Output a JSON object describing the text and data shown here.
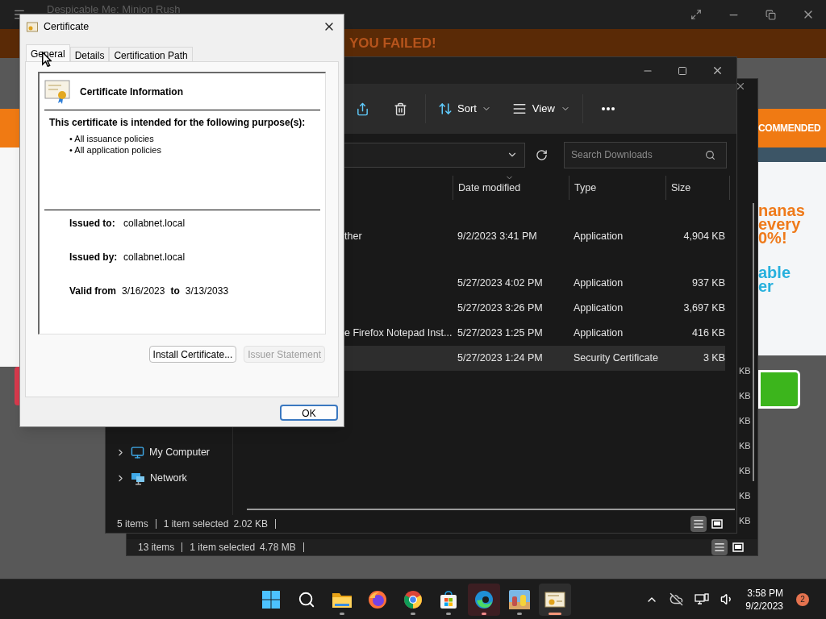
{
  "game": {
    "title": "Despicable Me: Minion Rush",
    "banner": "YOU FAILED!",
    "ribbon": "COMMENDED",
    "promo_orange": [
      "nanas",
      "every",
      "0%!"
    ],
    "promo_blue": [
      "able",
      "er"
    ]
  },
  "back_explorer": {
    "size_fragments": [
      "KB",
      "KB",
      "KB",
      "KB",
      "KB",
      "KB",
      "KB"
    ],
    "status": {
      "count": "13 items",
      "selection": "1 item selected",
      "size": "4.78 MB"
    },
    "view_modes": [
      {
        "kind": "details",
        "selected": true
      },
      {
        "kind": "tiles",
        "selected": false
      }
    ]
  },
  "explorer": {
    "toolbar": [
      {
        "kind": "share"
      },
      {
        "kind": "delete"
      },
      {
        "kind": "sort",
        "label": "Sort"
      },
      {
        "kind": "view",
        "label": "View"
      },
      {
        "kind": "more"
      }
    ],
    "search": {
      "placeholder": "Search Downloads"
    },
    "columns": [
      "Date modified",
      "Type",
      "Size"
    ],
    "groups": [
      {
        "rows": [
          {
            "name": "ther",
            "date": "9/2/2023 3:41 PM",
            "type": "Application",
            "size": "4,904 KB",
            "selected": false
          }
        ]
      },
      {
        "rows": [
          {
            "date": "5/27/2023 4:02 PM",
            "type": "Application",
            "size": "937 KB",
            "selected": false
          },
          {
            "date": "5/27/2023 3:26 PM",
            "type": "Application",
            "size": "3,697 KB",
            "selected": false
          },
          {
            "name": "e Firefox Notepad Inst...",
            "date": "5/27/2023 1:25 PM",
            "type": "Application",
            "size": "416 KB",
            "selected": false
          },
          {
            "date": "5/27/2023 1:24 PM",
            "type": "Security Certificate",
            "size": "3 KB",
            "selected": true
          }
        ]
      }
    ],
    "nav": [
      {
        "kind": "computer",
        "label": "My Computer"
      },
      {
        "kind": "network",
        "label": "Network"
      }
    ],
    "status": {
      "count": "5 items",
      "selection": "1 item selected",
      "size": "2.02 KB"
    },
    "view_modes": [
      {
        "kind": "details",
        "selected": true
      },
      {
        "kind": "tiles",
        "selected": false
      }
    ]
  },
  "dialog": {
    "title": "Certificate",
    "tabs": [
      {
        "label": "General",
        "selected": true
      },
      {
        "label": "Details",
        "selected": false
      },
      {
        "label": "Certification Path",
        "selected": false
      }
    ],
    "heading": "Certificate Information",
    "purpose_intro": "This certificate is intended for the following purpose(s):",
    "purposes": [
      "• All issuance policies",
      "• All application policies"
    ],
    "issued_to": {
      "label": "Issued to:",
      "value": "collabnet.local"
    },
    "issued_by": {
      "label": "Issued by:",
      "value": "collabnet.local"
    },
    "validity": {
      "label": "Valid from",
      "from": "3/16/2023",
      "joiner": "to",
      "to": "3/13/2033"
    },
    "buttons": [
      {
        "label": "Install Certificate...",
        "disabled": false
      },
      {
        "label": "Issuer Statement",
        "disabled": true
      }
    ],
    "ok": "OK"
  },
  "taskbar": {
    "apps": [
      {
        "kind": "start",
        "open": false,
        "attention": false,
        "selected": false
      },
      {
        "kind": "search",
        "open": false,
        "attention": false,
        "selected": false
      },
      {
        "kind": "folder",
        "open": true,
        "attention": false,
        "selected": false
      },
      {
        "kind": "firefox",
        "open": false,
        "attention": false,
        "selected": false
      },
      {
        "kind": "chrome",
        "open": true,
        "attention": false,
        "selected": false
      },
      {
        "kind": "store",
        "open": true,
        "attention": false,
        "selected": false
      },
      {
        "kind": "edge",
        "open": true,
        "attention": true,
        "selected": false
      },
      {
        "kind": "game",
        "open": true,
        "attention": false,
        "selected": false
      },
      {
        "kind": "certificate",
        "open": true,
        "attention": false,
        "selected": true
      }
    ],
    "tray": [
      {
        "kind": "chevron"
      },
      {
        "kind": "cloud-off"
      },
      {
        "kind": "network"
      },
      {
        "kind": "volume"
      }
    ],
    "time": "3:58 PM",
    "date": "9/2/2023",
    "notifications": "2"
  }
}
